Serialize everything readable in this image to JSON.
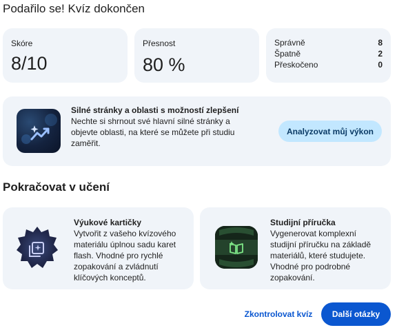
{
  "header": {
    "title": "Podařilo se! Kvíz dokončen"
  },
  "stats": {
    "score_label": "Skóre",
    "score_value": "8/10",
    "accuracy_label": "Přesnost",
    "accuracy_value": "80 %",
    "counts": [
      {
        "label": "Správně",
        "value": "8"
      },
      {
        "label": "Špatně",
        "value": "2"
      },
      {
        "label": "Přeskočeno",
        "value": "0"
      }
    ]
  },
  "analysis": {
    "heading": "Silné stránky a oblasti s možností zlepšení",
    "description": "Nechte si shrnout své hlavní silné stránky a objevte oblasti, na které se můžete při studiu zaměřit.",
    "button_label": "Analyzovat můj výkon",
    "icon": "trending-up-sparkle-icon"
  },
  "continue_section": {
    "title": "Pokračovat v učení",
    "cards": [
      {
        "heading": "Výukové kartičky",
        "description": "Vytvořit z vašeho kvízového materiálu úplnou sadu karet flash. Vhodné pro rychlé zopakování a zvládnutí klíčových konceptů.",
        "icon": "flashcards-icon"
      },
      {
        "heading": "Studijní příručka",
        "description": "Vygenerovat komplexní studijní příručku na základě materiálů, které studujete. Vhodné pro podrobné zopakování.",
        "icon": "study-guide-book-icon"
      }
    ]
  },
  "footer": {
    "review_label": "Zkontrolovat kvíz",
    "next_label": "Další otázky"
  },
  "colors": {
    "card_bg": "#f0f4f9",
    "accent": "#0b57d0",
    "tonal_button": "#c2e7ff",
    "guide_icon": "#7ee787"
  }
}
